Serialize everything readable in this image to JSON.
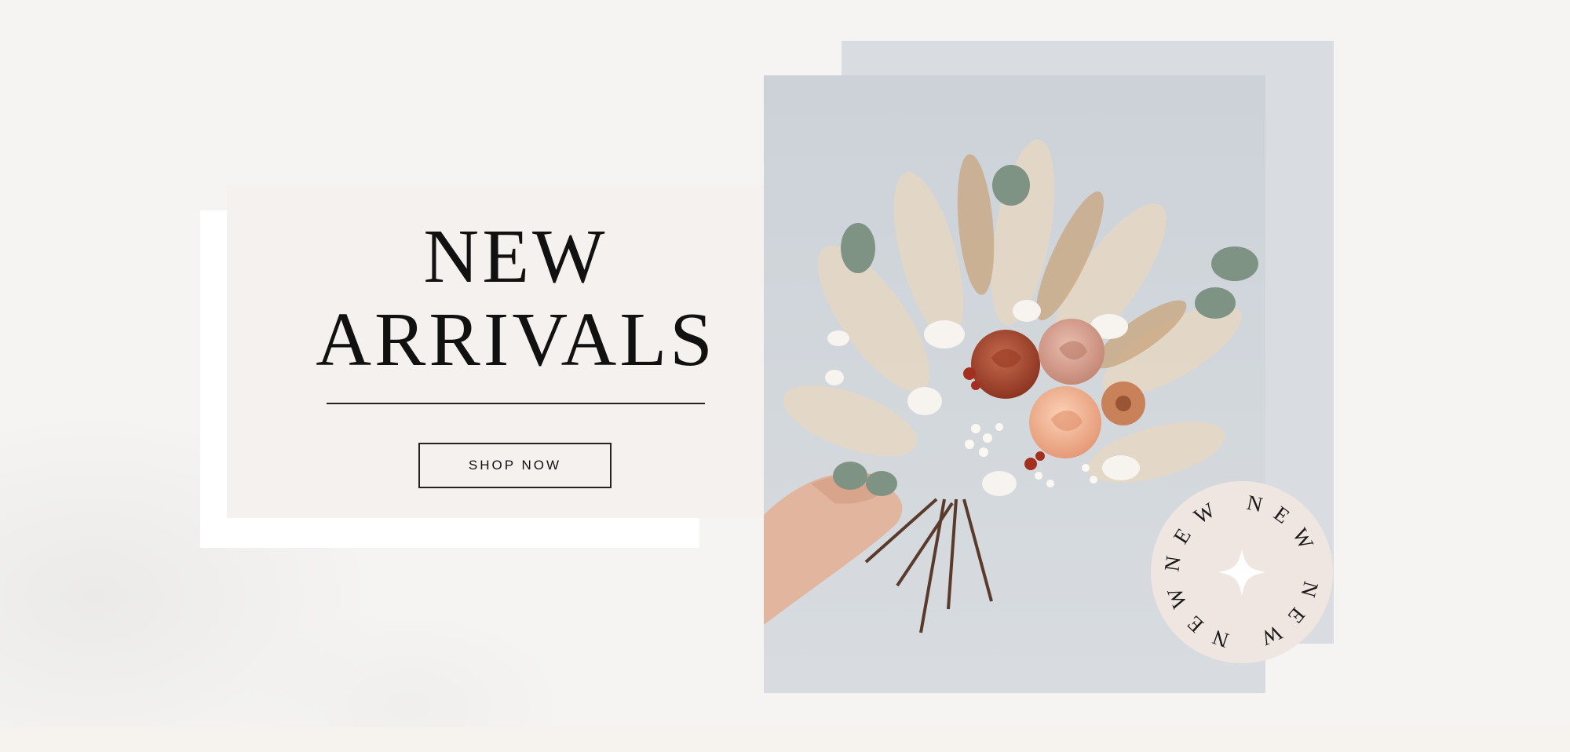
{
  "hero": {
    "headline_line1": "NEW",
    "headline_line2": "ARRIVALS",
    "cta_label": "SHOP NOW"
  },
  "badge": {
    "ring_text": "NEW NEW NEW NEW",
    "icon": "sparkle-icon"
  },
  "product_image": {
    "subject": "dried-flower-bouquet"
  },
  "colors": {
    "card_bg": "#f5f1ee",
    "text": "#111111",
    "photo_bg": "#d3d8dd",
    "badge_bg": "#efe6e1",
    "rose_rust": "#a5452d",
    "rose_blush": "#d9a08f",
    "rose_peach": "#f2b28f"
  }
}
